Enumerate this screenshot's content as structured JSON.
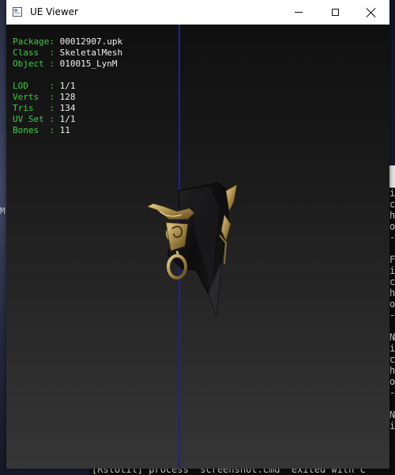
{
  "window": {
    "title": "UE Viewer"
  },
  "info": {
    "package_key": "Package:",
    "package_value": "00012907.upk",
    "class_key": "Class  :",
    "class_value": "SkeletalMesh",
    "object_key": "Object :",
    "object_value": "010015_LynM",
    "lod_key": "LOD    :",
    "lod_value": "1/1",
    "verts_key": "Verts  :",
    "verts_value": "128",
    "tris_key": "Tris   :",
    "tris_value": "134",
    "uvset_key": "UV Set :",
    "uvset_value": "1/1",
    "bones_key": "Bones  :",
    "bones_value": "11"
  },
  "console": {
    "right_lines": [
      "i",
      "c",
      "h",
      "o",
      "-",
      "",
      "F",
      "i",
      "c",
      "h",
      "o",
      "-",
      "",
      "N",
      "i",
      "c",
      "h",
      "o",
      "-",
      "",
      "N",
      "i"
    ],
    "bottom_line": "[RstUtil] process \"screenshot.cmd\" exited with c",
    "left_char": "M"
  },
  "colors": {
    "info_key": "#39d13c",
    "info_value": "#f2f2f2",
    "axis_line": "#1c20a8"
  }
}
